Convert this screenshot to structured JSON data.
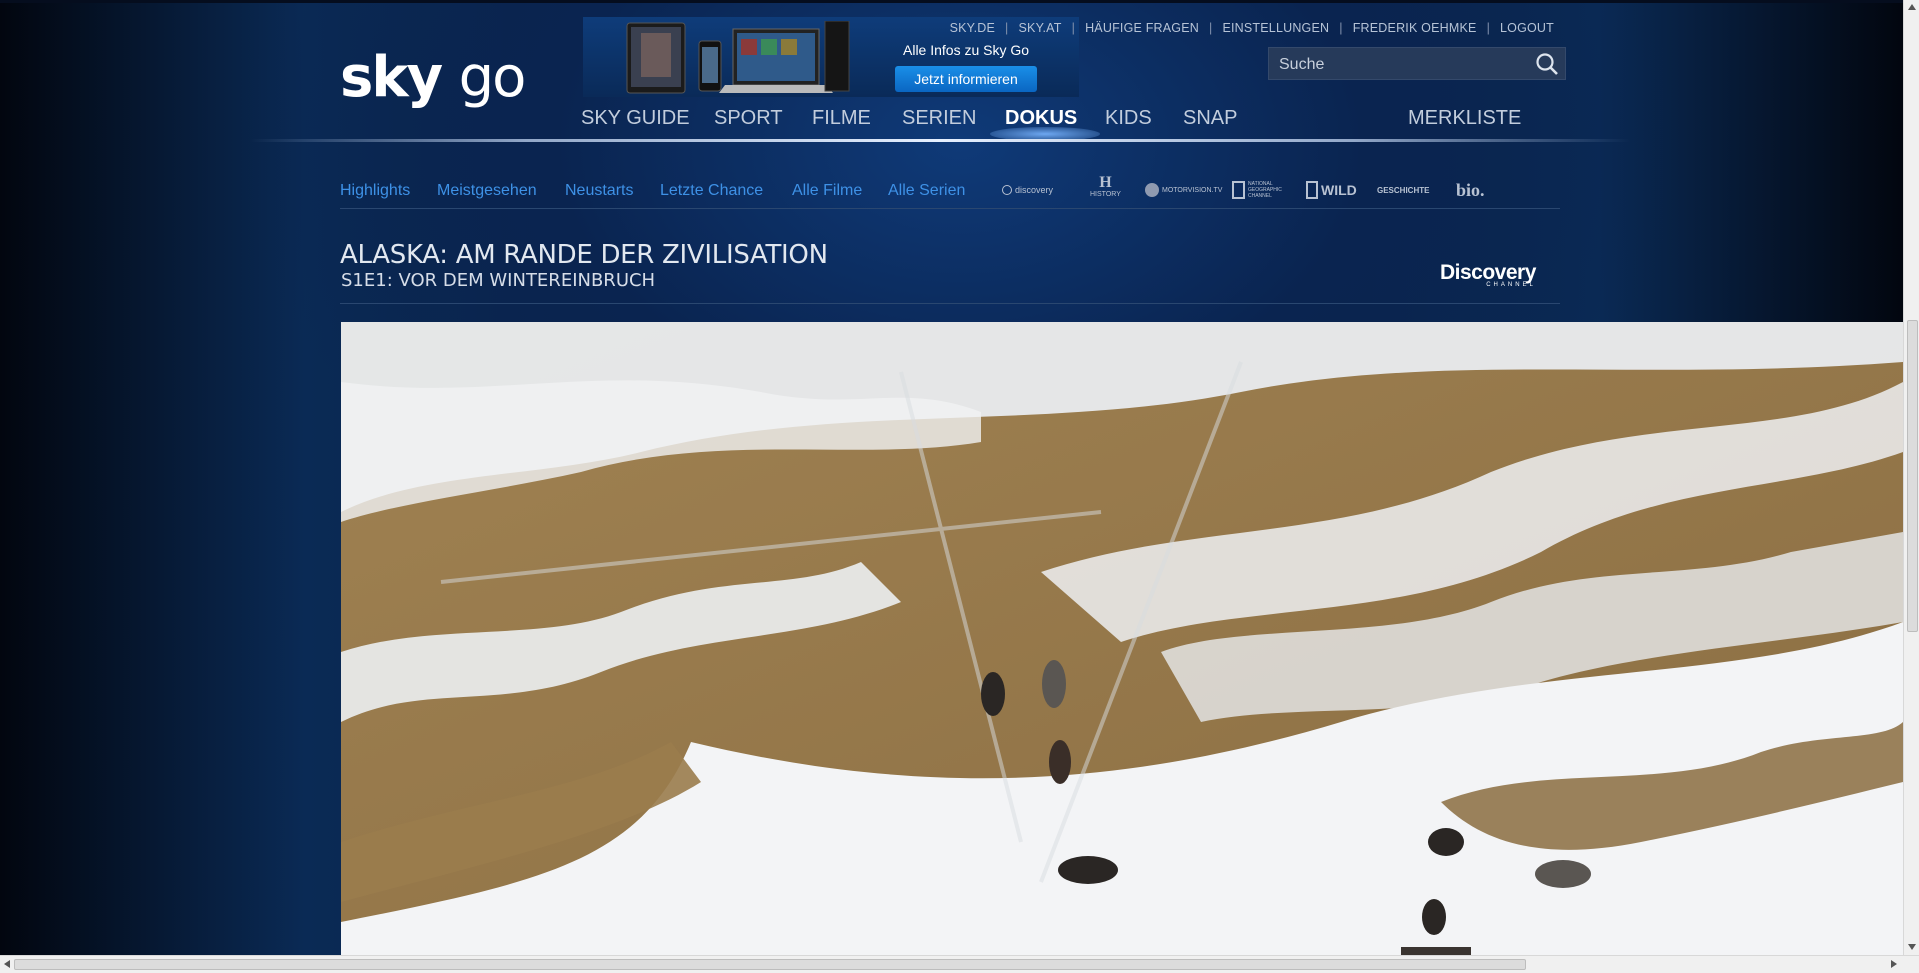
{
  "logo": {
    "sky": "sky",
    "go": "go"
  },
  "promo": {
    "text": "Alle Infos zu Sky Go",
    "button": "Jetzt informieren"
  },
  "toplinks": [
    "SKY.DE",
    "SKY.AT",
    "HÄUFIGE FRAGEN",
    "EINSTELLUNGEN",
    "FREDERIK OEHMKE",
    "LOGOUT"
  ],
  "search": {
    "placeholder": "Suche"
  },
  "mainnav": {
    "items": [
      "SKY GUIDE",
      "SPORT",
      "FILME",
      "SERIEN",
      "DOKUS",
      "KIDS",
      "SNAP"
    ],
    "active": "DOKUS",
    "merkliste": "MERKLISTE"
  },
  "subnav": {
    "items": [
      "Highlights",
      "Meistgesehen",
      "Neustarts",
      "Letzte Chance",
      "Alle Filme",
      "Alle Serien"
    ],
    "channels": [
      "discovery",
      "HISTORY",
      "MOTORVISION.TV",
      "NATIONAL GEOGRAPHIC CHANNEL",
      "WILD",
      "GESCHICHTE",
      "bio."
    ]
  },
  "show": {
    "title": "ALASKA: AM RANDE DER ZIVILISATION",
    "episode": "S1E1: VOR DEM WINTEREINBRUCH",
    "channel_logo": "Discovery",
    "channel_logo_sub": "CHANNEL"
  },
  "colors": {
    "accent": "#0a66c2",
    "subnav_link": "#3e91e6",
    "background": "#071b3c"
  }
}
